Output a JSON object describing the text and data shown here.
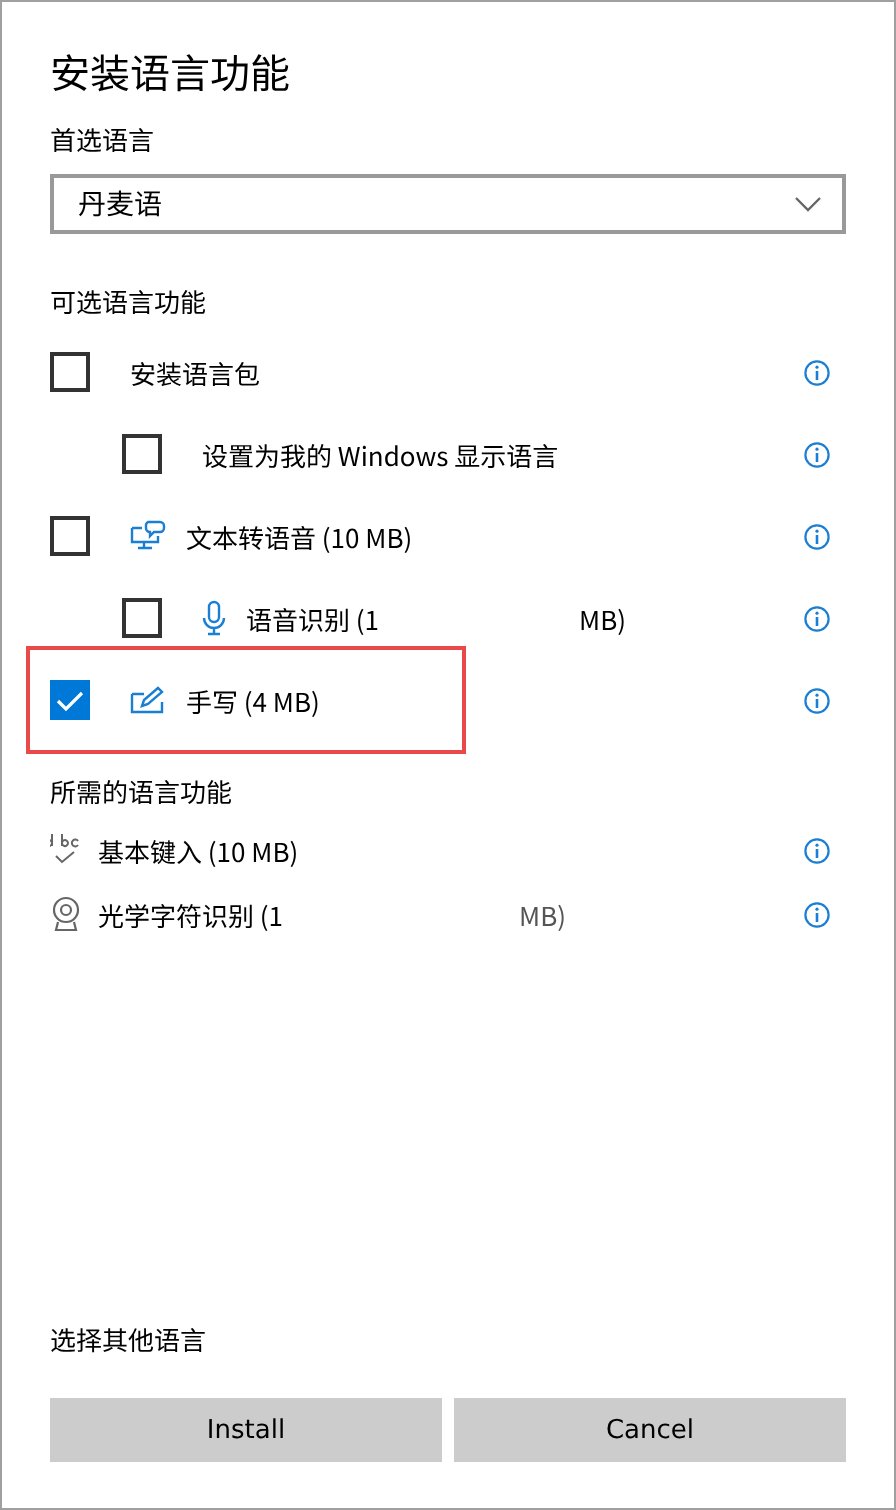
{
  "title": "安装语言功能",
  "preferred": {
    "label": "首选语言",
    "value": "丹麦语"
  },
  "optional": {
    "heading": "可选语言功能",
    "items": [
      {
        "label": "安装语言包",
        "kind": "plain",
        "checked": false,
        "highlighted": false,
        "children": [
          {
            "label": "设置为我的 Windows 显示语言",
            "kind": "plain",
            "checked": false,
            "highlighted": false
          }
        ]
      },
      {
        "label": "文本转语音 (10 MB)",
        "kind": "speech",
        "checked": false,
        "highlighted": false,
        "children": [
          {
            "label": "语音识别 (1",
            "label_tail": "MB)",
            "kind": "mic",
            "checked": false,
            "highlighted": false
          }
        ]
      },
      {
        "label": "手写 (4 MB)",
        "kind": "pen",
        "checked": true,
        "highlighted": true
      }
    ]
  },
  "required": {
    "heading": "所需的语言功能",
    "items": [
      {
        "label": "基本键入 (10 MB)",
        "kind": "abc"
      },
      {
        "label": "光学字符识别 (1",
        "label_tail": "MB)",
        "kind": "camera"
      }
    ]
  },
  "other_link": "选择其他语言",
  "buttons": [
    "Install",
    "Cancel"
  ]
}
